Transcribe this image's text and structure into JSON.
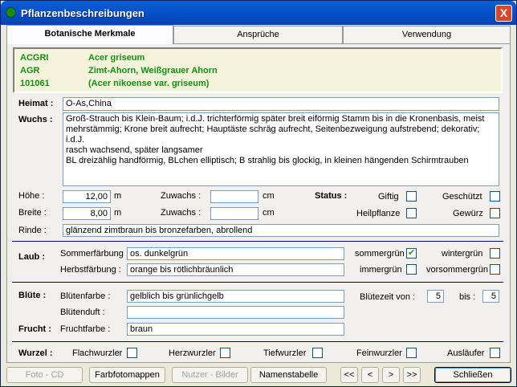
{
  "window": {
    "title": "Pflanzenbeschreibungen",
    "close_glyph": "X"
  },
  "tabs": [
    {
      "label": "Botanische Merkmale",
      "active": true
    },
    {
      "label": "Ansprüche",
      "active": false
    },
    {
      "label": "Verwendung",
      "active": false
    }
  ],
  "names": [
    {
      "code": "ACGRI",
      "text": "Acer griseum"
    },
    {
      "code": "AGR",
      "text": "Zimt-Ahorn, Weißgrauer Ahorn"
    },
    {
      "code": "101061",
      "text": "(Acer nikoense var. griseum)"
    }
  ],
  "heimat": {
    "label": "Heimat :",
    "value": "O-As,China"
  },
  "wuchs": {
    "label": "Wuchs :",
    "lines": [
      "Groß-Strauch bis Klein-Baum; i.d.J. trichterförmig später breit eiförmig Stamm bis in die Kronenbasis, meist",
      "mehrstämmig; Krone breit aufrecht; Hauptäste schräg aufrecht, Seitenbezweigung aufstrebend; dekorativ; i.d.J.",
      "rasch wachsend, später langsamer",
      "BL dreizählig handförmig, BLchen elliptisch; B strahlig bis glockig, in kleinen hängenden Schirmtrauben"
    ]
  },
  "hoehe": {
    "label": "Höhe :",
    "value": "12,00",
    "unit": "m"
  },
  "breite": {
    "label": "Breite :",
    "value": "8,00",
    "unit": "m"
  },
  "zuwachs1": {
    "label": "Zuwachs :",
    "value": "",
    "unit": "cm"
  },
  "zuwachs2": {
    "label": "Zuwachs :",
    "value": "",
    "unit": "cm"
  },
  "status": {
    "label": "Status :",
    "giftig": "Giftig",
    "geschuetzt": "Geschützt",
    "heilpflanze": "Heilpflanze",
    "gewuerz": "Gewürz"
  },
  "rinde": {
    "label": "Rinde :",
    "value": "glänzend zimtbraun bis bronzefarben, abrollend"
  },
  "laub": {
    "label": "Laub :",
    "sommer_label": "Sommerfärbung :",
    "sommer_value": "os. dunkelgrün",
    "herbst_label": "Herbstfärbung :",
    "herbst_value": "orange bis rötlichbräunlich",
    "sommergruen": "sommergrün",
    "wintergruen": "wintergrün",
    "immergruen": "immergrün",
    "vorsommergruen": "vorsommergrün"
  },
  "bluete": {
    "label": "Blüte :",
    "farbe_label": "Blütenfarbe :",
    "farbe_value": "gelblich bis grünlichgelb",
    "duft_label": "Blütenduft :",
    "duft_value": "",
    "zeit_label": "Blütezeit von :",
    "zeit_von": "5",
    "bis_label": "bis :",
    "zeit_bis": "5"
  },
  "frucht": {
    "label": "Frucht :",
    "farbe_label": "Fruchtfarbe :",
    "farbe_value": "braun"
  },
  "wurzel": {
    "label": "Wurzel :",
    "flach": "Flachwurzler",
    "herz": "Herzwurzler",
    "tief": "Tiefwurzler",
    "fein": "Feinwurzler",
    "auslaeufer": "Ausläufer"
  },
  "buttons": {
    "foto": "Foto - CD",
    "farbfoto": "Farbfotomappen",
    "nutzer": "Nutzer - Bilder",
    "namens": "Namenstabelle",
    "first": "<<",
    "prev": "<",
    "next": ">",
    "last": ">>",
    "schliessen": "Schließen"
  }
}
